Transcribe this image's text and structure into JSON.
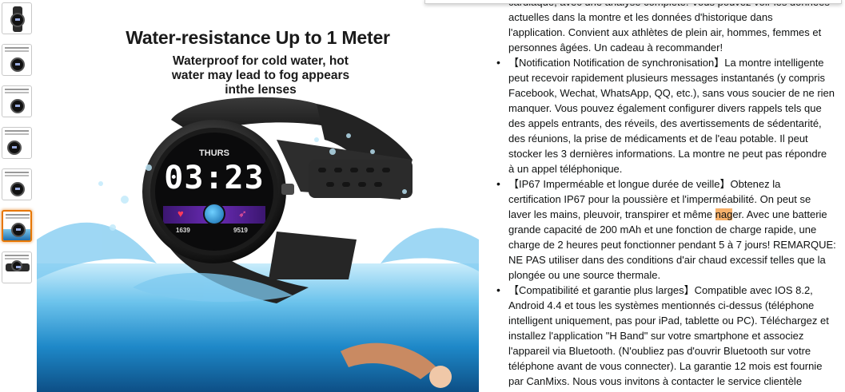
{
  "thumbnails": [
    {
      "label": "thumbnail-1",
      "selected": false
    },
    {
      "label": "thumbnail-2",
      "selected": false
    },
    {
      "label": "thumbnail-3",
      "selected": false
    },
    {
      "label": "thumbnail-4",
      "selected": false
    },
    {
      "label": "thumbnail-5",
      "selected": false
    },
    {
      "label": "thumbnail-6",
      "selected": true
    },
    {
      "label": "thumbnail-7",
      "selected": false
    }
  ],
  "image": {
    "title": "Water-resistance Up to 1 Meter",
    "subtitle_lines": [
      "Waterproof for cold water, hot",
      "water may lead to fog appears",
      "inthe lenses"
    ],
    "watch_day": "THURS",
    "watch_time": "03:23",
    "watch_left_stat": "1639",
    "watch_right_stat": "9519"
  },
  "description": {
    "intro_lines": [
      "cardiaque, avec une analyse complète. Vous pouvez voir les données",
      "actuelles dans la montre et les données d'historique dans",
      "l'application. Convient aux athlètes de plein air, hommes, femmes et",
      "personnes âgées. Un cadeau à recommander!"
    ],
    "bullets": [
      {
        "lines": [
          "【Notification Notification de synchronisation】La montre intelligente",
          "peut recevoir rapidement plusieurs messages instantanés (y compris",
          "Facebook, Wechat, WhatsApp, QQ, etc.), sans vous soucier de ne rien",
          "manquer. Vous pouvez également configurer divers rappels tels que",
          "des appels entrants, des réveils, des avertissements de sédentarité,",
          "des réunions, la prise de médicaments et de l'eau potable. Il peut",
          "stocker les 3 dernières informations. La montre ne peut pas répondre",
          "à un appel téléphonique."
        ]
      },
      {
        "lines": [
          "【IP67 Imperméable et longue durée de veille】Obtenez la",
          "certification IP67 pour la poussière et l'imperméabilité. On peut se"
        ],
        "hl_line_before": "laver les mains, pleuvoir, transpirer et même ",
        "hl_word": "nag",
        "hl_line_after": "er. Avec une batterie",
        "lines_after": [
          "grande capacité de 200 mAh et une fonction de charge rapide, une",
          "charge de 2 heures peut fonctionner pendant 5 à 7 jours! REMARQUE:",
          "NE PAS utiliser dans des conditions d'air chaud excessif telles que la",
          "plongée ou une source thermale."
        ]
      },
      {
        "lines": [
          "【Compatibilité et garantie plus larges】Compatible avec IOS 8.2,",
          "Android 4.4 et tous les systèmes mentionnés ci-dessus (téléphone",
          "intelligent uniquement, pas pour iPad, tablette ou PC). Téléchargez et",
          "installez l'application \"H Band\" sur votre smartphone et associez",
          "l'appareil via Bluetooth. (N'oubliez pas d'ouvrir Bluetooth sur votre",
          "téléphone avant de vous connecter). La garantie 12 mois est fournie",
          "par CanMixs. Nous vous invitons à contacter le service clientèle"
        ]
      }
    ]
  }
}
